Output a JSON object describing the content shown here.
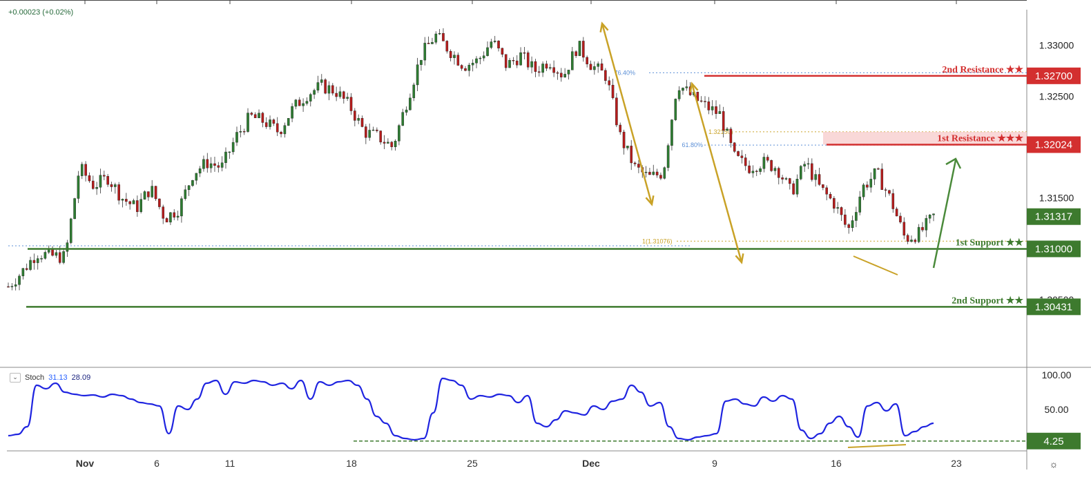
{
  "header": {
    "change_text": "+0.00023 (+0.02%)"
  },
  "stoch": {
    "name": "Stoch",
    "k": "31.13",
    "d": "28.09",
    "toggle_icon": "chevron-down-icon"
  },
  "colors": {
    "resistance": "#d32f2f",
    "support": "#3d7a2e",
    "price_tag": "#3d7a2e",
    "fib_arrow": "#c9a227",
    "bull_arrow": "#4a8a3a",
    "stoch_line": "#1f24e0",
    "candle_up": "#2e7d32",
    "candle_down": "#b71c1c",
    "fib_dotted": "#5b8fd6",
    "res_zone": "#f6c8c8"
  },
  "chart_data": {
    "type": "candlestick",
    "title": "",
    "price_axis": {
      "ticks": [
        "1.33000",
        "1.32500",
        "1.31500"
      ],
      "tick_values": [
        1.33,
        1.325,
        1.315
      ],
      "partial_tick": "1.30500",
      "ylim": [
        1.2985,
        1.3335
      ]
    },
    "date_axis": {
      "ticks": [
        "Nov",
        "6",
        "11",
        "18",
        "25",
        "Dec",
        "9",
        "16",
        "23"
      ]
    },
    "price_tags": [
      {
        "label": "1.32700",
        "value": 1.327,
        "kind": "resistance"
      },
      {
        "label": "1.32024",
        "value": 1.32024,
        "kind": "resistance"
      },
      {
        "label": "1.31317",
        "value": 1.31317,
        "kind": "current"
      },
      {
        "label": "1.31000",
        "value": 1.31,
        "kind": "support"
      },
      {
        "label": "1.30431",
        "value": 1.30431,
        "kind": "support"
      }
    ],
    "levels": [
      {
        "name": "2nd Resistance ★★",
        "value": 1.327,
        "kind": "resistance"
      },
      {
        "name": "1st Resistance ★★★",
        "value": 1.32024,
        "kind": "resistance",
        "zone_top": 1.3215
      },
      {
        "name": "1st Support ★★",
        "value": 1.31,
        "kind": "support"
      },
      {
        "name": "2nd Support ★★",
        "value": 1.30431,
        "kind": "support"
      }
    ],
    "fib_labels": [
      {
        "text": "76.40%",
        "value": 1.3273
      },
      {
        "text": "61.80%",
        "value": 1.3202
      },
      {
        "text": "1.32150)",
        "value": 1.3215
      },
      {
        "text": "1(1.31076)",
        "value": 1.31076
      }
    ],
    "price_path": [
      1.3063,
      1.3078,
      1.3096,
      1.3093,
      1.3092,
      1.318,
      1.3162,
      1.317,
      1.315,
      1.314,
      1.316,
      1.313,
      1.314,
      1.3175,
      1.3185,
      1.318,
      1.321,
      1.323,
      1.3225,
      1.3215,
      1.3238,
      1.3252,
      1.326,
      1.3255,
      1.324,
      1.3215,
      1.321,
      1.32,
      1.3245,
      1.329,
      1.331,
      1.3295,
      1.328,
      1.3285,
      1.3305,
      1.328,
      1.329,
      1.3275,
      1.3285,
      1.327,
      1.33,
      1.328,
      1.327,
      1.321,
      1.318,
      1.317,
      1.3175,
      1.3263,
      1.325,
      1.324,
      1.3232,
      1.319,
      1.318,
      1.3185,
      1.318,
      1.3155,
      1.3185,
      1.316,
      1.3145,
      1.3118,
      1.316,
      1.3175,
      1.3148,
      1.311,
      1.3115,
      1.3132
    ],
    "stochastic": {
      "values": [
        12,
        14,
        25,
        85,
        80,
        88,
        75,
        72,
        70,
        71,
        68,
        72,
        70,
        65,
        60,
        58,
        55,
        15,
        55,
        50,
        65,
        88,
        92,
        72,
        90,
        88,
        92,
        90,
        85,
        88,
        80,
        92,
        65,
        90,
        85,
        90,
        92,
        85,
        65,
        40,
        30,
        12,
        8,
        6,
        8,
        45,
        95,
        92,
        85,
        65,
        70,
        68,
        72,
        70,
        60,
        70,
        30,
        25,
        35,
        48,
        45,
        42,
        55,
        50,
        62,
        65,
        85,
        75,
        55,
        60,
        25,
        8,
        6,
        10,
        12,
        15,
        62,
        65,
        58,
        55,
        68,
        62,
        70,
        65,
        20,
        8,
        15,
        30,
        40,
        25,
        10,
        55,
        60,
        48,
        58,
        12,
        18,
        25,
        30
      ],
      "ticks": [
        "100.00",
        "50.00"
      ],
      "tick_values": [
        100,
        50
      ],
      "tag": {
        "label": "4.25",
        "value": 4.25
      },
      "ylim": [
        -7,
        110
      ]
    }
  }
}
